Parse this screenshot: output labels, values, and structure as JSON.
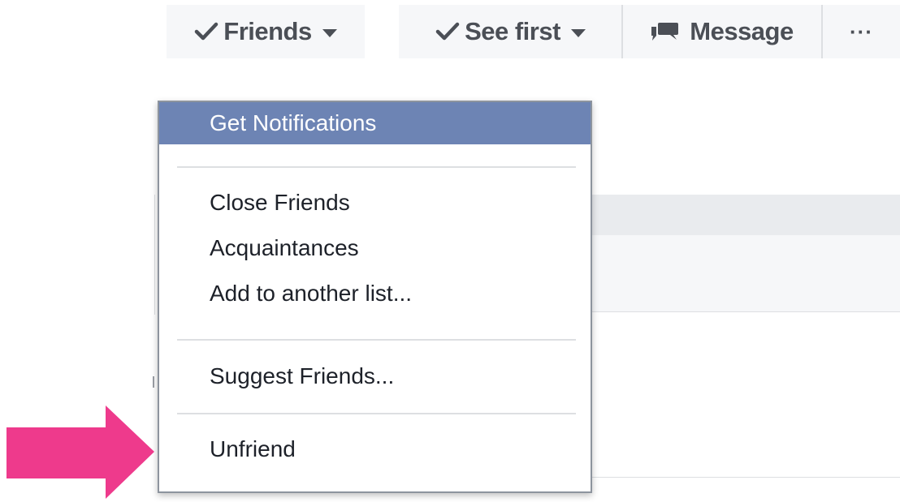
{
  "toolbar": {
    "friends_label": "Friends",
    "see_first_label": "See first",
    "message_label": "Message",
    "more_label": "···"
  },
  "menu": {
    "items": [
      {
        "label": "Get Notifications",
        "highlighted": true
      },
      {
        "label": "Close Friends"
      },
      {
        "label": "Acquaintances"
      },
      {
        "label": "Add to another list..."
      },
      {
        "label": "Suggest Friends..."
      },
      {
        "label": "Unfriend"
      }
    ]
  },
  "icons": {
    "check": "check-icon",
    "caret": "caret-down-icon",
    "message": "message-bubble-icon",
    "more": "more-dots-icon"
  },
  "colors": {
    "highlight": "#6d84b4",
    "arrow": "#ee3a8c",
    "button_bg": "#f6f7f9",
    "button_text": "#4b4f56"
  }
}
